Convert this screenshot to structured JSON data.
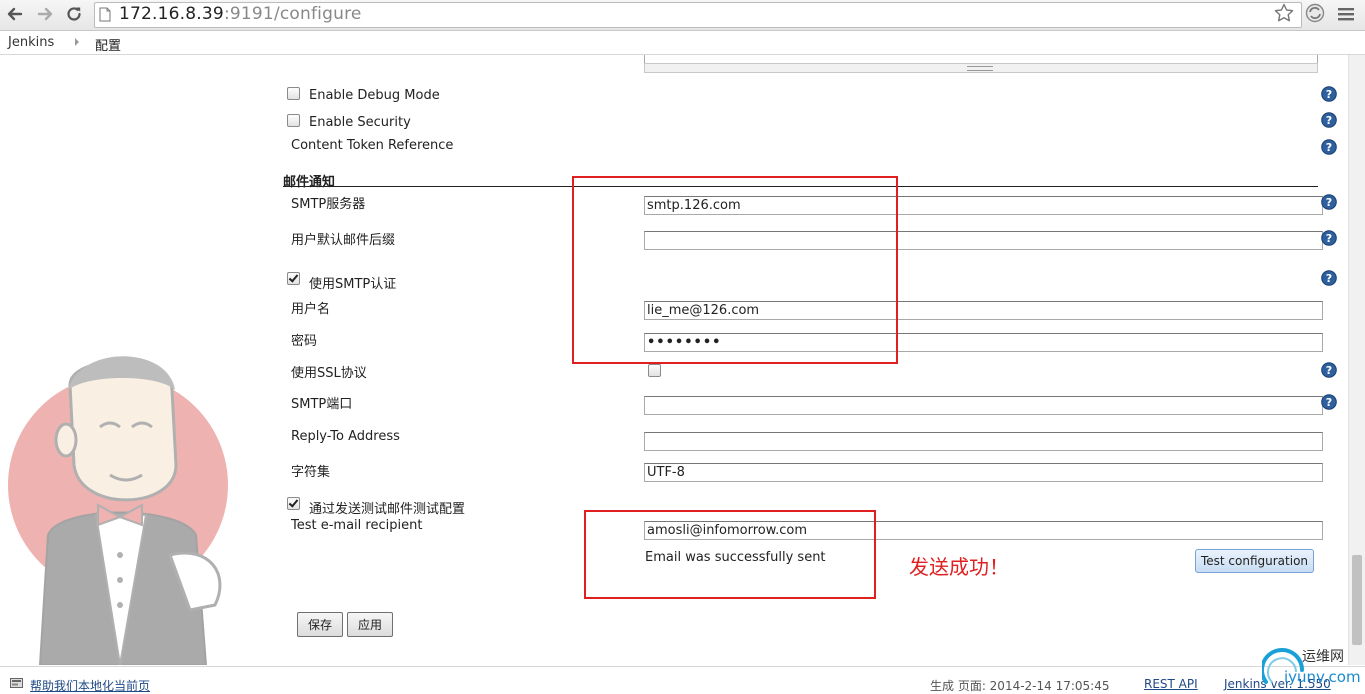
{
  "browser": {
    "url_host": "172.16.8.39",
    "url_rest": ":9191/configure"
  },
  "breadcrumb": {
    "root": "Jenkins",
    "current": "配置"
  },
  "global": {
    "debug_label": "Enable Debug Mode",
    "debug_checked": false,
    "security_label": "Enable Security",
    "security_checked": false,
    "content_token_label": "Content Token Reference"
  },
  "email": {
    "section_title": "邮件通知",
    "smtp_server_label": "SMTP服务器",
    "smtp_server_value": "smtp.126.com",
    "default_suffix_label": "用户默认邮件后缀",
    "default_suffix_value": "",
    "use_auth_label": "使用SMTP认证",
    "use_auth_checked": true,
    "username_label": "用户名",
    "username_value": "lie_me@126.com",
    "password_label": "密码",
    "password_value": "••••••••",
    "ssl_label": "使用SSL协议",
    "ssl_checked": false,
    "port_label": "SMTP端口",
    "port_value": "",
    "reply_to_label": "Reply-To Address",
    "reply_to_value": "",
    "charset_label": "字符集",
    "charset_value": "UTF-8",
    "test_toggle_label": "通过发送测试邮件测试配置",
    "test_toggle_checked": true,
    "test_recipient_label": "Test e-mail recipient",
    "test_recipient_value": "amosli@infomorrow.com",
    "test_result": "Email was successfully sent",
    "test_button": "Test configuration",
    "annotation": "发送成功！"
  },
  "actions": {
    "save": "保存",
    "apply": "应用"
  },
  "footer": {
    "localize_link": "帮助我们本地化当前页",
    "generated": "生成 页面: 2014-2-14 17:05:45",
    "rest_api": "REST API",
    "version": "Jenkins ver. 1.550"
  },
  "watermark": {
    "cn": "运维网",
    "site": "iyunv.com"
  },
  "colors": {
    "annotation_red": "#e02020",
    "link_blue": "#204a87",
    "help_blue": "#2e5f9e"
  }
}
